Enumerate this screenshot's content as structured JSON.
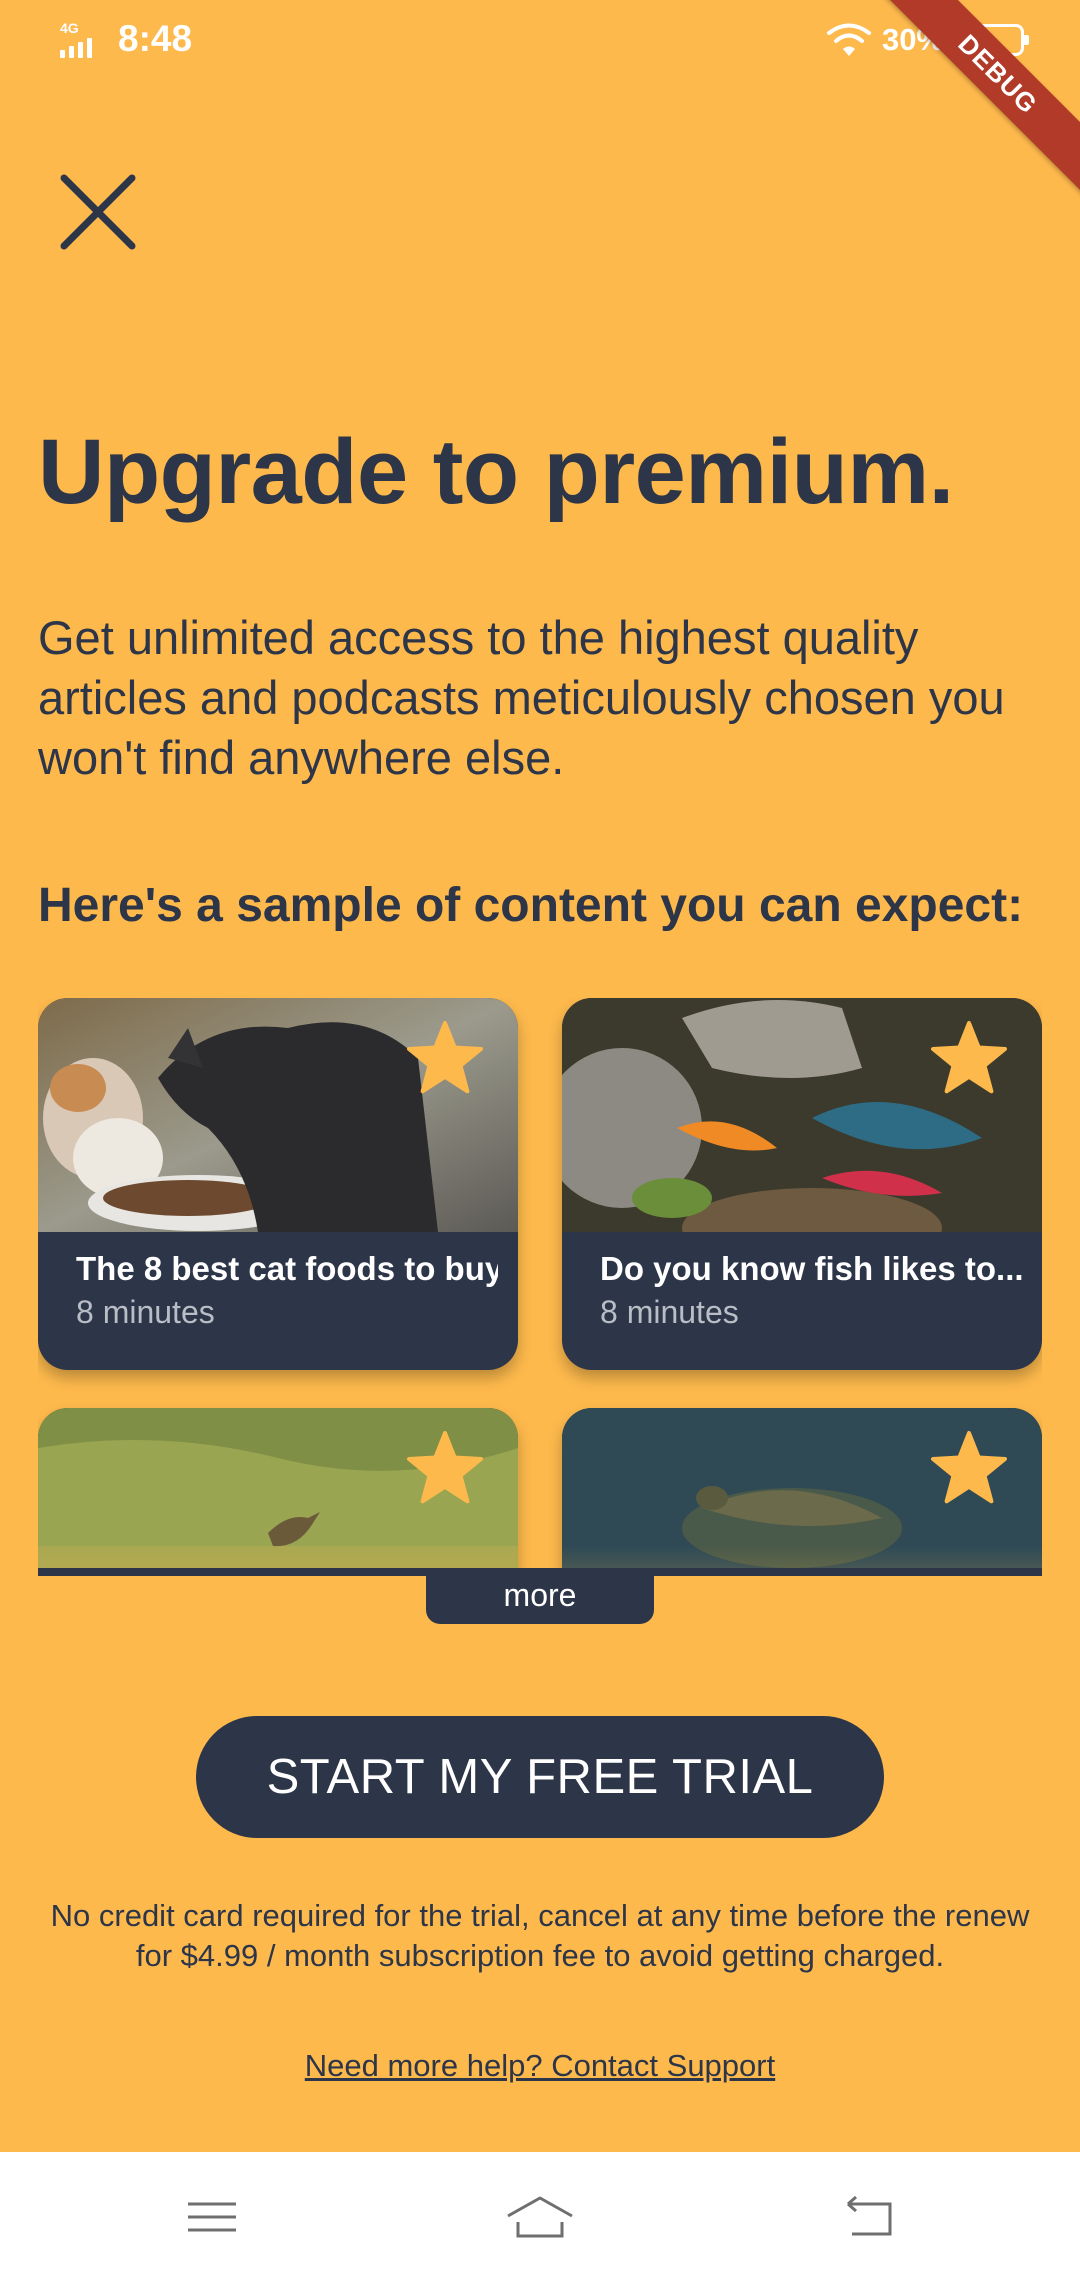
{
  "status_bar": {
    "network": "4G",
    "time": "8:48",
    "battery": "30%",
    "icons": [
      "signal-icon",
      "wifi-icon",
      "battery-icon"
    ]
  },
  "debug_banner": "DEBUG",
  "close_icon": "close-icon",
  "title": "Upgrade to premium.",
  "description": "Get unlimited access to the highest quality articles and podcasts meticulously chosen you won't find anywhere else.",
  "sample_heading": "Here's a sample of content you can expect:",
  "cards": [
    {
      "title": "The 8 best cat foods to buy",
      "meta": "8 minutes",
      "icon": "star-icon"
    },
    {
      "title": "Do you know fish likes to...",
      "meta": "8 minutes",
      "icon": "star-icon"
    },
    {
      "title": "",
      "meta": "",
      "icon": "star-icon"
    },
    {
      "title": "",
      "meta": "",
      "icon": "star-icon"
    }
  ],
  "more_label": "more",
  "cta_label": "START MY FREE TRIAL",
  "disclaimer": "No credit card required for the trial, cancel at any time before the renew for $4.99 / month subscription fee to avoid getting charged.",
  "support_link": "Need more help? Contact Support",
  "nav_icons": [
    "menu-icon",
    "home-icon",
    "back-icon"
  ],
  "colors": {
    "background": "#FDB94C",
    "primary_dark": "#2D3548",
    "star": "#FDB94C",
    "debug_ribbon": "#B23A28"
  }
}
